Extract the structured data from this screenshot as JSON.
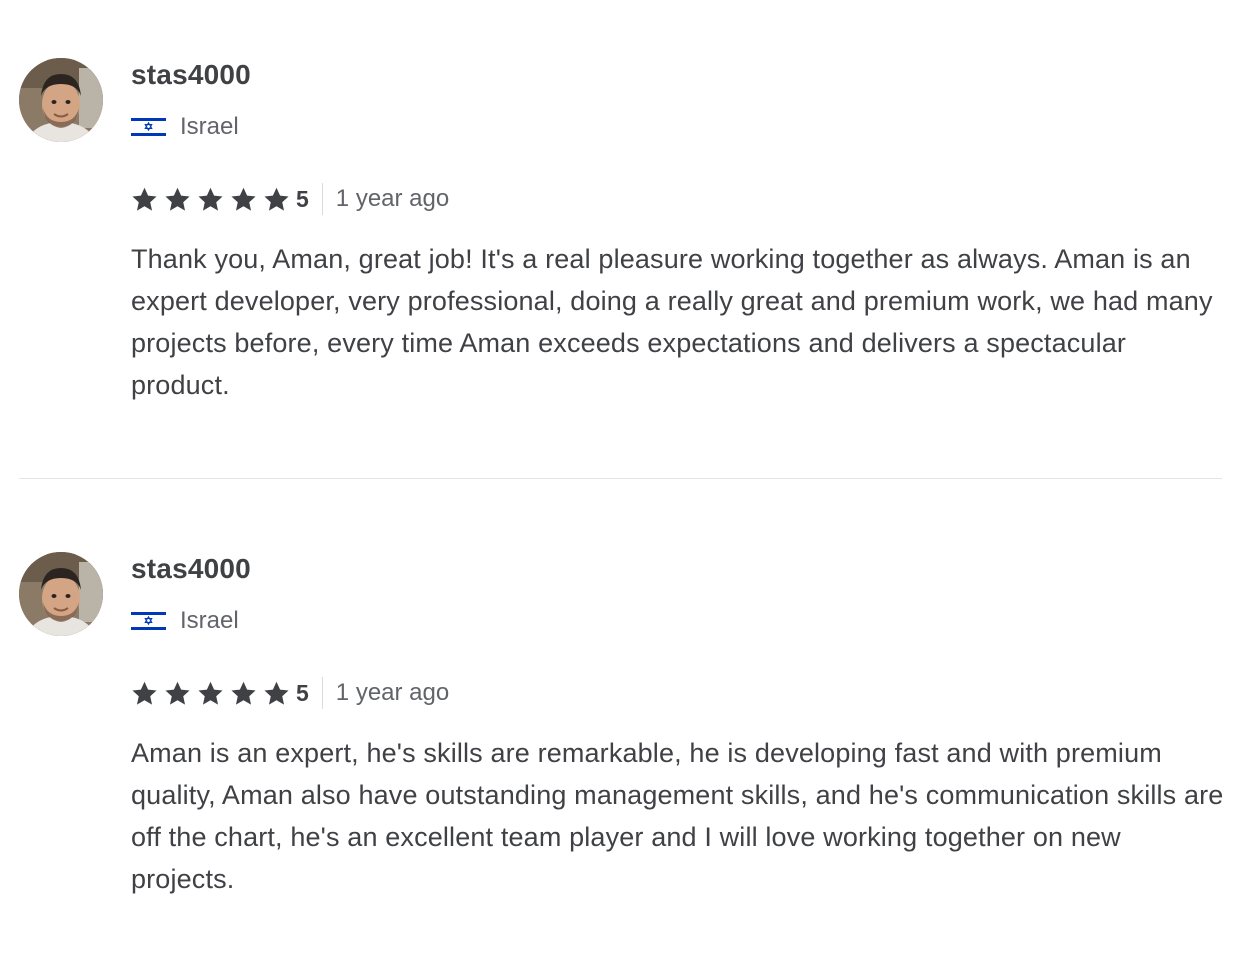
{
  "reviews": [
    {
      "username": "stas4000",
      "country": "Israel",
      "rating": 5,
      "score_label": "5",
      "time": "1 year ago",
      "text": "Thank you, Aman, great job! It's a real pleasure working together as always. Aman is an expert developer, very professional, doing a really great and premium work, we had many projects before, every time Aman exceeds expectations and delivers a spectacular product."
    },
    {
      "username": "stas4000",
      "country": "Israel",
      "rating": 5,
      "score_label": "5",
      "time": "1 year ago",
      "text": "Aman is an expert, he's skills are remarkable, he is developing fast and with premium quality, Aman also have outstanding management skills, and he's communication skills are off the chart, he's an excellent team player and I will love working together on new projects."
    }
  ],
  "icons": {
    "star": "star-icon",
    "flag": "israel-flag-icon",
    "avatar": "avatar"
  },
  "colors": {
    "text_primary": "#404145",
    "text_secondary": "#62646a",
    "star": "#404145",
    "flag_blue": "#0038b8",
    "separator": "#e4e5e7"
  }
}
